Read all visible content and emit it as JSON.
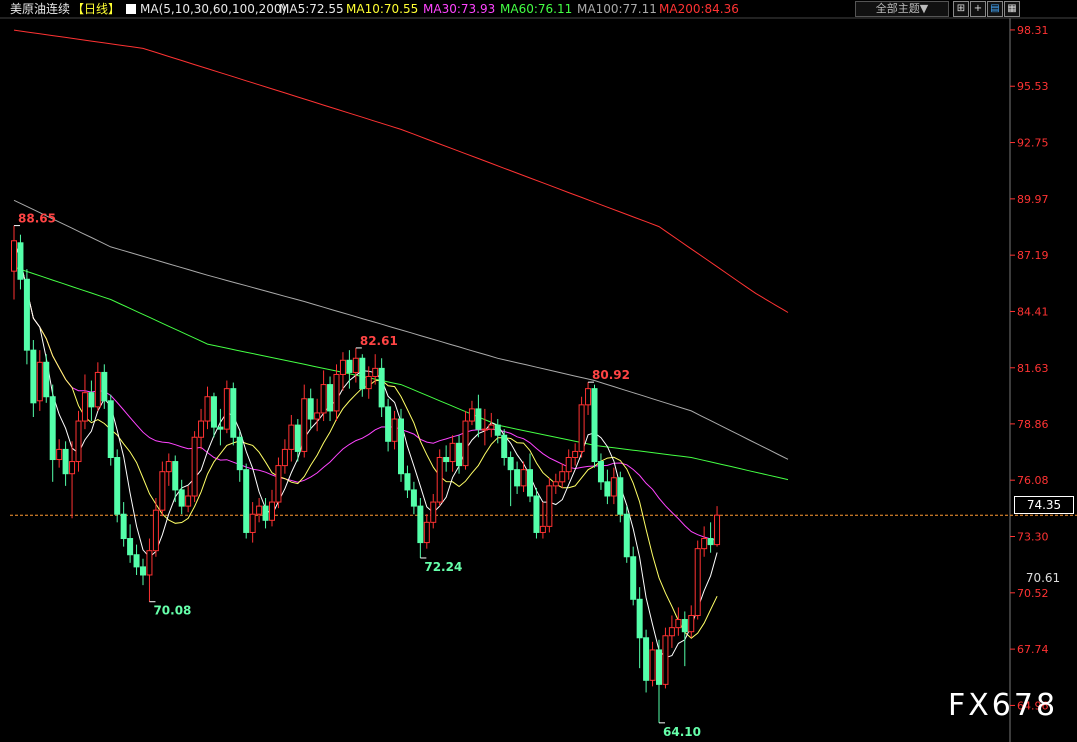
{
  "header": {
    "instrument": "美原油连续",
    "period": "【日线】",
    "ma_params": "MA(5,10,30,60,100,200)",
    "ma5": "MA5:72.55",
    "ma10": "MA10:70.55",
    "ma30": "MA30:73.93",
    "ma60": "MA60:76.11",
    "ma100": "MA100:77.11",
    "ma200": "MA200:84.36",
    "theme_button": "全部主题▼"
  },
  "toolbar_icons": [
    "expand-icon",
    "plus-icon",
    "chart-icon",
    "grid-icon"
  ],
  "watermark": "FX678",
  "current_price": "74.35",
  "ma200_tag": "70.61",
  "colors": {
    "up": "#ff3232",
    "down": "#54ffaa",
    "ma5": "#ffffff",
    "ma10": "#ffff66",
    "ma30": "#ff44ff",
    "ma60": "#44ff44",
    "ma100": "#aaaaaa",
    "ma200": "#ff3333",
    "axis_text": "#ff3333",
    "price_line": "#ff9933"
  },
  "chart_data": {
    "type": "candlestick",
    "ylim": [
      63.5,
      98.8
    ],
    "y_ticks": [
      98.31,
      95.53,
      92.75,
      89.97,
      87.19,
      84.41,
      81.63,
      78.86,
      76.08,
      73.3,
      70.52,
      67.74,
      64.96
    ],
    "y_tick_labels": [
      "98.31",
      "95.53",
      "92.75",
      "89.97",
      "87.19",
      "84.41",
      "81.63",
      "78.86",
      "76.08",
      "73.30",
      "70.52",
      "67.74",
      "64.96"
    ],
    "annotations": [
      {
        "text": "88.65",
        "index": 0,
        "value": 88.65,
        "kind": "high"
      },
      {
        "text": "70.08",
        "index": 21,
        "value": 70.08,
        "kind": "low"
      },
      {
        "text": "82.61",
        "index": 53,
        "value": 82.61,
        "kind": "high"
      },
      {
        "text": "72.24",
        "index": 63,
        "value": 72.24,
        "kind": "low"
      },
      {
        "text": "80.92",
        "index": 89,
        "value": 80.92,
        "kind": "high"
      },
      {
        "text": "64.10",
        "index": 100,
        "value": 64.1,
        "kind": "low"
      }
    ],
    "current_price": 74.35,
    "candles": [
      [
        86.4,
        87.9,
        88.65,
        85.0
      ],
      [
        87.8,
        86.0,
        88.2,
        85.5
      ],
      [
        86.0,
        82.5,
        86.5,
        81.8
      ],
      [
        82.5,
        79.9,
        83.0,
        79.2
      ],
      [
        80.0,
        81.9,
        82.5,
        79.5
      ],
      [
        81.9,
        80.2,
        82.3,
        79.9
      ],
      [
        80.2,
        77.1,
        80.8,
        76.0
      ],
      [
        77.1,
        77.6,
        78.1,
        76.7
      ],
      [
        77.6,
        76.4,
        78.0,
        75.8
      ],
      [
        76.4,
        77.0,
        78.0,
        74.2
      ],
      [
        77.0,
        79.0,
        79.5,
        76.5
      ],
      [
        79.0,
        80.4,
        81.3,
        78.6
      ],
      [
        80.4,
        79.7,
        81.0,
        79.0
      ],
      [
        79.7,
        81.4,
        81.9,
        79.5
      ],
      [
        81.4,
        80.0,
        81.8,
        79.6
      ],
      [
        80.0,
        77.2,
        80.3,
        76.8
      ],
      [
        77.2,
        74.4,
        77.6,
        74.0
      ],
      [
        74.4,
        73.2,
        75.0,
        72.8
      ],
      [
        73.2,
        72.4,
        73.9,
        72.0
      ],
      [
        72.4,
        71.8,
        72.9,
        71.4
      ],
      [
        71.8,
        71.4,
        72.2,
        70.9
      ],
      [
        71.4,
        72.6,
        73.2,
        70.08
      ],
      [
        72.6,
        74.6,
        75.2,
        72.3
      ],
      [
        74.6,
        76.5,
        77.0,
        74.3
      ],
      [
        76.5,
        77.0,
        77.4,
        75.8
      ],
      [
        77.0,
        75.6,
        77.3,
        75.0
      ],
      [
        75.6,
        74.8,
        76.1,
        74.4
      ],
      [
        74.8,
        75.3,
        75.8,
        74.5
      ],
      [
        75.3,
        78.2,
        78.5,
        75.0
      ],
      [
        78.2,
        79.0,
        79.6,
        77.6
      ],
      [
        79.0,
        80.2,
        80.7,
        78.6
      ],
      [
        80.2,
        78.7,
        80.4,
        78.2
      ],
      [
        78.7,
        78.6,
        79.6,
        77.8
      ],
      [
        78.6,
        80.6,
        81.0,
        78.4
      ],
      [
        80.6,
        78.2,
        80.9,
        77.8
      ],
      [
        78.2,
        76.6,
        78.5,
        76.0
      ],
      [
        76.6,
        73.5,
        76.9,
        73.2
      ],
      [
        73.5,
        74.4,
        75.0,
        73.0
      ],
      [
        74.4,
        74.8,
        75.2,
        74.0
      ],
      [
        74.8,
        74.1,
        75.2,
        73.7
      ],
      [
        74.1,
        75.0,
        75.6,
        73.8
      ],
      [
        75.0,
        76.8,
        77.2,
        74.7
      ],
      [
        76.8,
        77.6,
        78.1,
        76.4
      ],
      [
        77.6,
        78.8,
        79.3,
        77.0
      ],
      [
        78.8,
        77.5,
        79.1,
        77.0
      ],
      [
        77.5,
        80.1,
        80.8,
        77.2
      ],
      [
        80.1,
        79.1,
        80.6,
        78.6
      ],
      [
        79.1,
        79.4,
        80.1,
        78.5
      ],
      [
        79.4,
        80.8,
        81.5,
        79.0
      ],
      [
        80.8,
        79.5,
        81.2,
        79.0
      ],
      [
        79.5,
        81.3,
        81.8,
        79.0
      ],
      [
        81.3,
        82.0,
        82.4,
        80.5
      ],
      [
        82.0,
        81.4,
        82.5,
        80.6
      ],
      [
        81.4,
        82.1,
        82.61,
        80.9
      ],
      [
        82.1,
        80.6,
        82.3,
        80.2
      ],
      [
        80.6,
        81.2,
        81.7,
        80.1
      ],
      [
        81.2,
        81.6,
        82.3,
        80.8
      ],
      [
        81.6,
        79.7,
        82.1,
        79.2
      ],
      [
        79.7,
        78.0,
        80.1,
        77.5
      ],
      [
        78.0,
        79.1,
        79.5,
        77.6
      ],
      [
        79.1,
        76.4,
        79.6,
        76.0
      ],
      [
        76.4,
        75.6,
        76.8,
        75.2
      ],
      [
        75.6,
        74.8,
        76.0,
        74.4
      ],
      [
        74.8,
        73.0,
        75.2,
        72.24
      ],
      [
        73.0,
        74.0,
        74.4,
        72.7
      ],
      [
        74.0,
        75.0,
        75.4,
        73.7
      ],
      [
        75.0,
        77.2,
        77.6,
        74.8
      ],
      [
        77.2,
        77.0,
        77.8,
        76.5
      ],
      [
        77.0,
        77.9,
        78.3,
        76.5
      ],
      [
        77.9,
        76.8,
        78.3,
        76.4
      ],
      [
        76.8,
        79.0,
        79.5,
        76.6
      ],
      [
        79.0,
        79.6,
        80.0,
        78.8
      ],
      [
        79.6,
        78.6,
        80.3,
        78.2
      ],
      [
        78.6,
        78.6,
        79.6,
        77.8
      ],
      [
        78.6,
        78.8,
        79.4,
        78.2
      ],
      [
        78.8,
        78.3,
        79.1,
        77.9
      ],
      [
        78.3,
        77.2,
        78.6,
        76.8
      ],
      [
        77.2,
        76.6,
        77.5,
        74.8
      ],
      [
        76.6,
        75.8,
        77.0,
        75.4
      ],
      [
        75.8,
        76.6,
        77.0,
        75.5
      ],
      [
        76.6,
        75.3,
        77.4,
        75.0
      ],
      [
        75.3,
        73.5,
        75.7,
        73.2
      ],
      [
        73.5,
        73.8,
        75.0,
        73.2
      ],
      [
        73.8,
        75.8,
        76.2,
        73.5
      ],
      [
        75.8,
        76.0,
        76.4,
        75.4
      ],
      [
        76.0,
        76.5,
        76.9,
        75.7
      ],
      [
        76.5,
        77.2,
        77.6,
        76.1
      ],
      [
        77.2,
        77.5,
        77.9,
        76.8
      ],
      [
        77.5,
        79.8,
        80.2,
        77.2
      ],
      [
        79.8,
        80.6,
        80.92,
        79.3
      ],
      [
        80.6,
        77.0,
        80.8,
        76.7
      ],
      [
        77.0,
        76.0,
        77.4,
        75.6
      ],
      [
        76.0,
        75.3,
        76.6,
        74.9
      ],
      [
        75.3,
        76.2,
        76.7,
        74.9
      ],
      [
        76.2,
        74.4,
        76.5,
        74.0
      ],
      [
        74.4,
        72.3,
        74.8,
        72.0
      ],
      [
        72.3,
        70.2,
        72.8,
        69.9
      ],
      [
        70.2,
        68.3,
        70.8,
        66.8
      ],
      [
        68.3,
        66.2,
        68.7,
        65.6
      ],
      [
        66.2,
        67.7,
        68.1,
        65.9
      ],
      [
        67.7,
        66.0,
        68.2,
        64.1
      ],
      [
        66.0,
        68.4,
        68.8,
        65.8
      ],
      [
        68.4,
        68.8,
        69.4,
        67.8
      ],
      [
        68.8,
        69.2,
        69.8,
        68.4
      ],
      [
        69.2,
        68.6,
        69.6,
        66.9
      ],
      [
        68.6,
        69.4,
        69.9,
        68.3
      ],
      [
        69.4,
        72.7,
        73.1,
        69.2
      ],
      [
        72.7,
        73.2,
        73.8,
        72.3
      ],
      [
        73.2,
        72.9,
        74.0,
        72.5
      ],
      [
        72.9,
        74.35,
        74.8,
        72.8
      ]
    ],
    "ma200": [
      [
        0,
        98.3
      ],
      [
        20,
        97.4
      ],
      [
        40,
        95.4
      ],
      [
        60,
        93.4
      ],
      [
        80,
        91.0
      ],
      [
        100,
        88.6
      ],
      [
        115,
        85.3
      ],
      [
        120,
        84.36
      ]
    ],
    "ma100": [
      [
        0,
        89.9
      ],
      [
        15,
        87.6
      ],
      [
        30,
        86.2
      ],
      [
        45,
        84.9
      ],
      [
        60,
        83.5
      ],
      [
        75,
        82.1
      ],
      [
        90,
        81.0
      ],
      [
        105,
        79.5
      ],
      [
        120,
        77.11
      ]
    ],
    "ma60": [
      [
        0,
        86.6
      ],
      [
        15,
        85.0
      ],
      [
        30,
        82.8
      ],
      [
        45,
        81.8
      ],
      [
        60,
        80.8
      ],
      [
        75,
        78.8
      ],
      [
        90,
        77.8
      ],
      [
        105,
        77.2
      ],
      [
        120,
        76.11
      ]
    ]
  }
}
